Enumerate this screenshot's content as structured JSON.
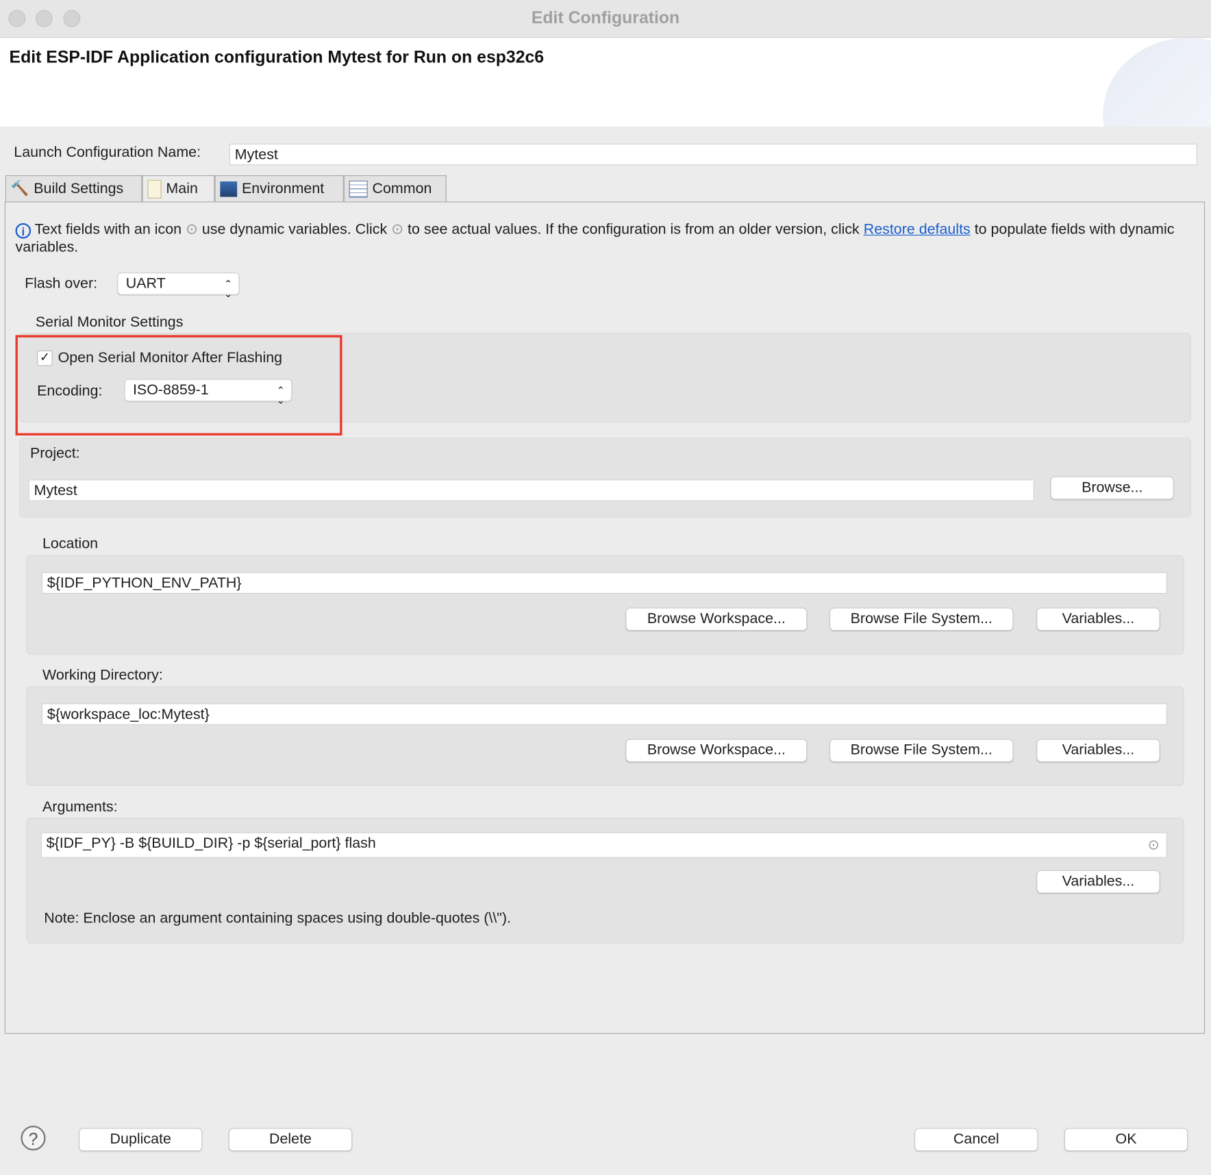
{
  "window": {
    "title": "Edit Configuration"
  },
  "header": {
    "title": "Edit ESP-IDF Application configuration Mytest for Run on esp32c6"
  },
  "config_name": {
    "label": "Launch Configuration Name:",
    "value": "Mytest"
  },
  "tabs": [
    {
      "label": "Build Settings",
      "icon": "hammer-icon"
    },
    {
      "label": "Main",
      "icon": "document-icon",
      "active": true
    },
    {
      "label": "Environment",
      "icon": "environment-icon"
    },
    {
      "label": "Common",
      "icon": "table-icon"
    }
  ],
  "info": {
    "part1": "Text fields with an icon",
    "part2": "use dynamic variables. Click",
    "part3": "to see actual values. If the configuration is from an older version, click",
    "link": "Restore defaults",
    "part4": "to populate fields with dynamic variables."
  },
  "flash": {
    "label": "Flash over:",
    "value": "UART"
  },
  "serial": {
    "title": "Serial Monitor Settings",
    "checkbox_label": "Open Serial Monitor After Flashing",
    "checked": true,
    "encoding_label": "Encoding:",
    "encoding_value": "ISO-8859-1",
    "highlight_color": "#e8392c"
  },
  "project": {
    "label": "Project:",
    "value": "Mytest",
    "browse": "Browse..."
  },
  "location": {
    "label": "Location",
    "value": "${IDF_PYTHON_ENV_PATH}",
    "browse_ws": "Browse Workspace...",
    "browse_fs": "Browse File System...",
    "variables": "Variables..."
  },
  "workdir": {
    "label": "Working Directory:",
    "value": "${workspace_loc:Mytest}",
    "browse_ws": "Browse Workspace...",
    "browse_fs": "Browse File System...",
    "variables": "Variables..."
  },
  "arguments": {
    "label": "Arguments:",
    "value": "${IDF_PY} -B ${BUILD_DIR} -p ${serial_port} flash",
    "variables": "Variables...",
    "note": "Note: Enclose an argument containing spaces using double-quotes (\\\\\")."
  },
  "footer": {
    "duplicate": "Duplicate",
    "delete": "Delete",
    "cancel": "Cancel",
    "ok": "OK"
  }
}
